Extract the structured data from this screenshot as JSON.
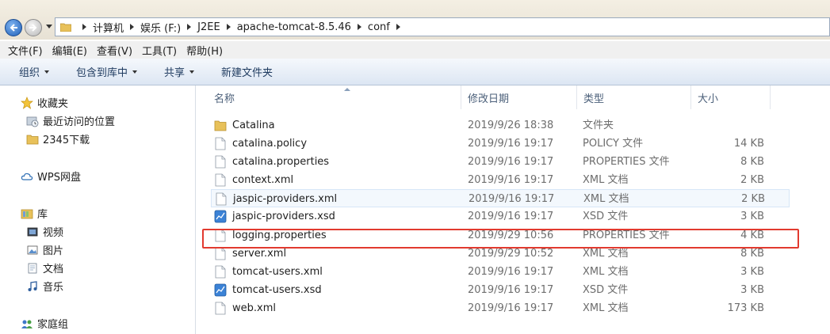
{
  "address": {
    "crumbs": [
      "计算机",
      "娱乐 (F:)",
      "J2EE",
      "apache-tomcat-8.5.46",
      "conf"
    ]
  },
  "menu": [
    "文件(F)",
    "编辑(E)",
    "查看(V)",
    "工具(T)",
    "帮助(H)"
  ],
  "toolbar": {
    "organize": "组织",
    "include_library": "包含到库中",
    "share": "共享",
    "new_folder": "新建文件夹"
  },
  "nav": {
    "favorites": "收藏夹",
    "recent": "最近访问的位置",
    "downloads_2345": "2345下载",
    "wps": "WPS网盘",
    "library": "库",
    "video": "视频",
    "pictures": "图片",
    "documents": "文档",
    "music": "音乐",
    "homegroup": "家庭组"
  },
  "columns": {
    "name": "名称",
    "date": "修改日期",
    "type": "类型",
    "size": "大小"
  },
  "files": [
    {
      "name": "Catalina",
      "date": "2019/9/26 18:38",
      "type": "文件夹",
      "size": "",
      "icon": "folder-icon"
    },
    {
      "name": "catalina.policy",
      "date": "2019/9/16 19:17",
      "type": "POLICY 文件",
      "size": "14 KB",
      "icon": "file-icon"
    },
    {
      "name": "catalina.properties",
      "date": "2019/9/16 19:17",
      "type": "PROPERTIES 文件",
      "size": "8 KB",
      "icon": "file-icon"
    },
    {
      "name": "context.xml",
      "date": "2019/9/16 19:17",
      "type": "XML 文档",
      "size": "2 KB",
      "icon": "file-icon"
    },
    {
      "name": "jaspic-providers.xml",
      "date": "2019/9/16 19:17",
      "type": "XML 文档",
      "size": "2 KB",
      "icon": "file-icon"
    },
    {
      "name": "jaspic-providers.xsd",
      "date": "2019/9/16 19:17",
      "type": "XSD 文件",
      "size": "3 KB",
      "icon": "xsd-file-icon"
    },
    {
      "name": "logging.properties",
      "date": "2019/9/29 10:56",
      "type": "PROPERTIES 文件",
      "size": "4 KB",
      "icon": "file-icon"
    },
    {
      "name": "server.xml",
      "date": "2019/9/29 10:52",
      "type": "XML 文档",
      "size": "8 KB",
      "icon": "file-icon"
    },
    {
      "name": "tomcat-users.xml",
      "date": "2019/9/16 19:17",
      "type": "XML 文档",
      "size": "3 KB",
      "icon": "file-icon"
    },
    {
      "name": "tomcat-users.xsd",
      "date": "2019/9/16 19:17",
      "type": "XSD 文件",
      "size": "3 KB",
      "icon": "xsd-file-icon"
    },
    {
      "name": "web.xml",
      "date": "2019/9/16 19:17",
      "type": "XML 文档",
      "size": "173 KB",
      "icon": "file-icon"
    }
  ],
  "colors": {
    "highlight_box": "#e23a2f",
    "toolbar_text": "#1e3a5f",
    "secondary_text": "#6d6d6d"
  }
}
